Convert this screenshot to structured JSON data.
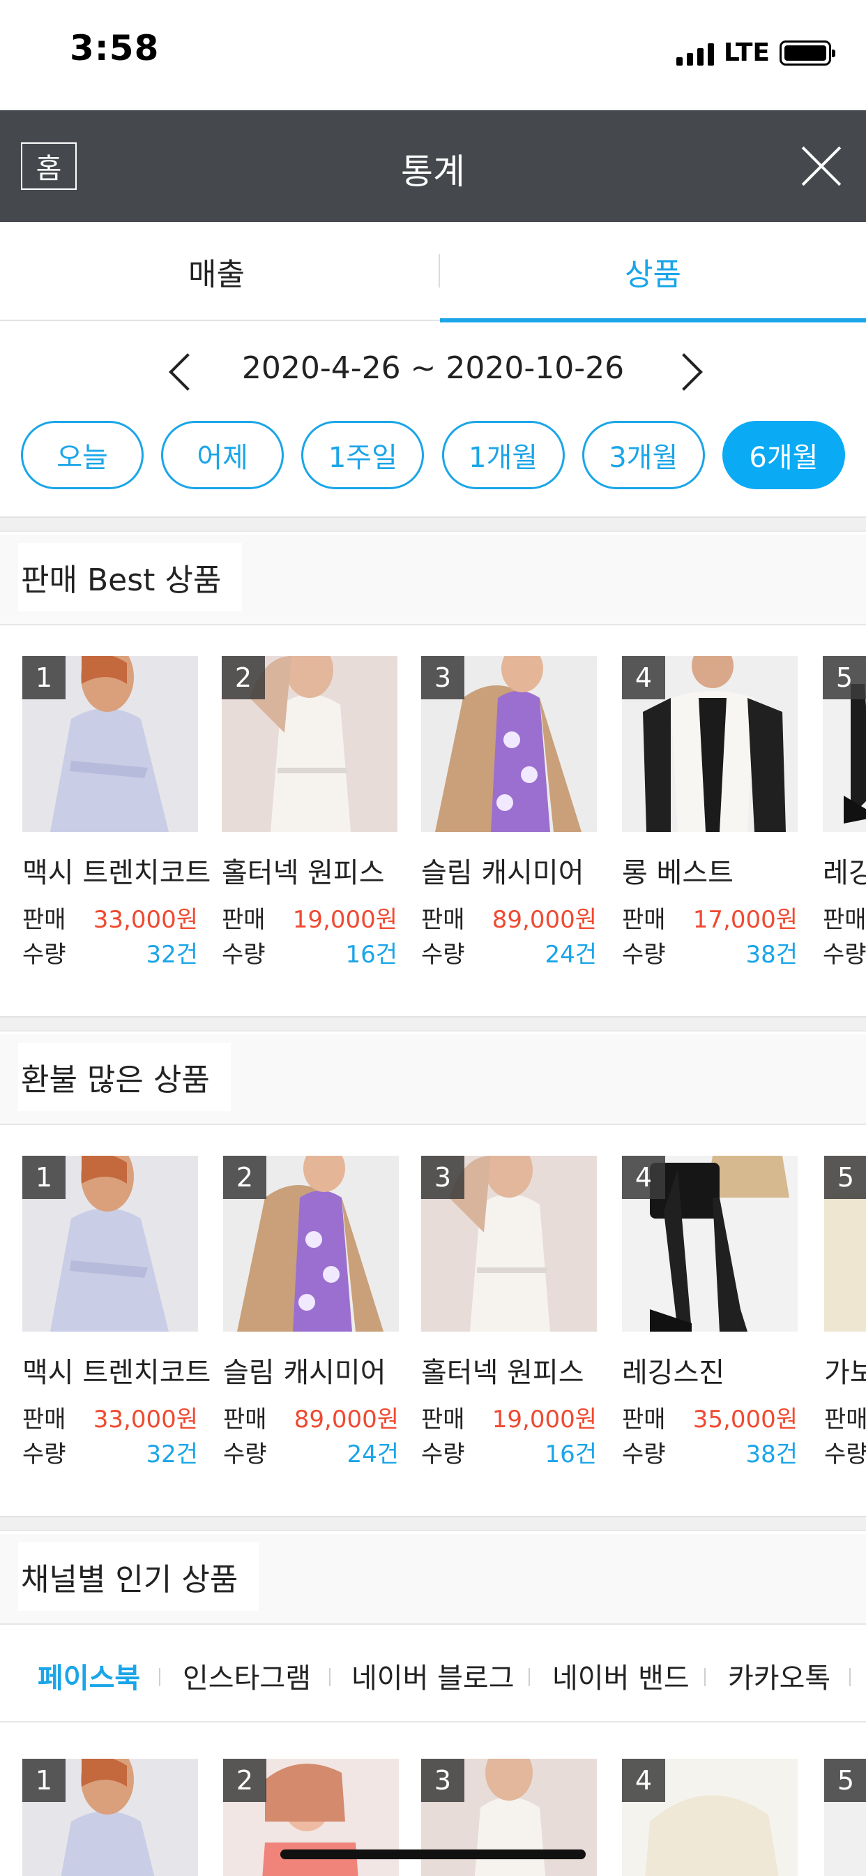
{
  "status_bar": {
    "time": "3:58",
    "network": "LTE"
  },
  "header": {
    "home_label": "홈",
    "title": "통계"
  },
  "tabs": [
    {
      "label": "매출",
      "active": false
    },
    {
      "label": "상품",
      "active": true
    }
  ],
  "date_range": "2020-4-26 ~ 2020-10-26",
  "periods": [
    {
      "label": "오늘",
      "active": false
    },
    {
      "label": "어제",
      "active": false
    },
    {
      "label": "1주일",
      "active": false
    },
    {
      "label": "1개월",
      "active": false
    },
    {
      "label": "3개월",
      "active": false
    },
    {
      "label": "6개월",
      "active": true
    }
  ],
  "labels": {
    "sale": "판매",
    "qty": "수량"
  },
  "colors": {
    "accent": "#1aa5e8",
    "active_pill": "#0aaaf5",
    "price": "#ef4a31",
    "header": "#45484c"
  },
  "best_section": {
    "title": "판매 Best 상품",
    "items": [
      {
        "rank": "1",
        "name": "맥시 트렌치코트",
        "price": "33,000원",
        "qty": "32건",
        "image": "lavender-trench-coat"
      },
      {
        "rank": "2",
        "name": "홀터넥 원피스",
        "price": "19,000원",
        "qty": "16건",
        "image": "white-halter-dress"
      },
      {
        "rank": "3",
        "name": "슬림 캐시미어",
        "price": "89,000원",
        "qty": "24건",
        "image": "camel-coat-floral"
      },
      {
        "rank": "4",
        "name": "롱 베스트",
        "price": "17,000원",
        "qty": "38건",
        "image": "white-long-vest"
      },
      {
        "rank": "5",
        "name": "레깅",
        "price": "",
        "qty": "",
        "image": "black-boots"
      }
    ]
  },
  "refund_section": {
    "title": "환불 많은 상품",
    "items": [
      {
        "rank": "1",
        "name": "맥시 트렌치코트",
        "price": "33,000원",
        "qty": "32건",
        "image": "lavender-trench-coat"
      },
      {
        "rank": "2",
        "name": "슬림 캐시미어",
        "price": "89,000원",
        "qty": "24건",
        "image": "camel-coat-floral"
      },
      {
        "rank": "3",
        "name": "홀터넥 원피스",
        "price": "19,000원",
        "qty": "16건",
        "image": "white-halter-dress"
      },
      {
        "rank": "4",
        "name": "레깅스진",
        "price": "35,000원",
        "qty": "38건",
        "image": "black-leggings-boots"
      },
      {
        "rank": "5",
        "name": "가보",
        "price": "",
        "qty": "",
        "image": "cream-item"
      }
    ]
  },
  "channel_section": {
    "title": "채널별 인기 상품",
    "channels": [
      {
        "label": "페이스북",
        "active": true
      },
      {
        "label": "인스타그램",
        "active": false
      },
      {
        "label": "네이버 블로그",
        "active": false
      },
      {
        "label": "네이버 밴드",
        "active": false
      },
      {
        "label": "카카오톡",
        "active": false
      }
    ],
    "items": [
      {
        "rank": "1",
        "image": "lavender-trench-coat"
      },
      {
        "rank": "2",
        "image": "coral-top"
      },
      {
        "rank": "3",
        "image": "white-halter-dress"
      },
      {
        "rank": "4",
        "image": "cream-skirt"
      },
      {
        "rank": "5",
        "image": "partial-item"
      }
    ]
  }
}
